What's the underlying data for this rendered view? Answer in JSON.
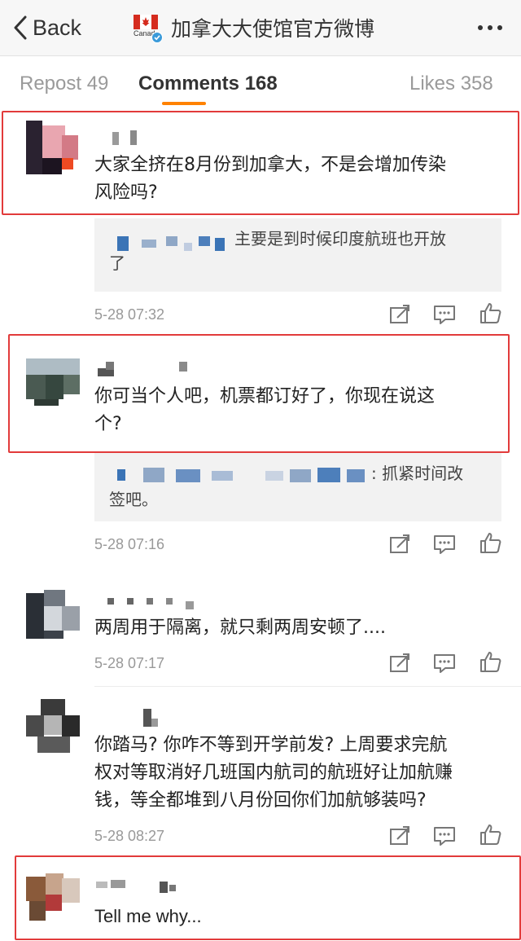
{
  "header": {
    "back_label": "Back",
    "title": "加拿大大使馆官方微博",
    "logo_label": "Canada"
  },
  "tabs": [
    {
      "label": "Repost 49"
    },
    {
      "label": "Comments 168"
    },
    {
      "label": "Likes 358"
    }
  ],
  "comments": [
    {
      "text_lines": [
        "大家全挤在8月份到加拿大，不是会增加传染",
        "风险吗?"
      ],
      "reply_lines": [
        "主要是到时候印度航班也开放",
        "了"
      ],
      "timestamp": "5-28 07:32"
    },
    {
      "text_lines": [
        "你可当个人吧，机票都订好了，你现在说这",
        "个?"
      ],
      "reply_lines": [
        ": 抓紧时间改",
        "签吧。"
      ],
      "timestamp": "5-28 07:16"
    },
    {
      "text_lines": [
        "两周用于隔离，就只剩两周安顿了...."
      ],
      "timestamp": "5-28 07:17"
    },
    {
      "text_lines": [
        "你踏马? 你咋不等到开学前发? 上周要求完航",
        "权对等取消好几班国内航司的航班好让加航赚",
        "钱，等全都堆到八月份回你们加航够装吗?"
      ],
      "timestamp": "5-28 08:27"
    },
    {
      "text_lines": [
        "Tell me why..."
      ]
    }
  ],
  "icons": [
    "back-chevron-icon",
    "canada-flag-icon",
    "verified-icon",
    "more-icon",
    "repost-icon",
    "comment-icon",
    "like-icon"
  ],
  "colors": {
    "accent": "#ff8200",
    "highlight": "#e23b3b",
    "verified": "#3a9ad9",
    "flag_red": "#d52b1e"
  }
}
